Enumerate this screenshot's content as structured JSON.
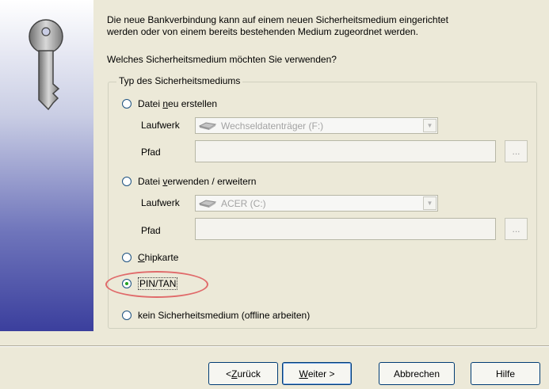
{
  "intro": {
    "line1": "Die neue Bankverbindung kann  auf einem neuen Sicherheitsmedium eingerichtet",
    "line2": "werden oder von einem bereits bestehenden Medium zugeordnet werden."
  },
  "question": "Welches Sicherheitsmedium möchten Sie verwenden?",
  "group_title": "Typ des Sicherheitsmediums",
  "options": {
    "new_file": {
      "pre": "Datei ",
      "access": "n",
      "post": "eu erstellen",
      "drive_label": "Laufwerk",
      "drive_value": "Wechseldatenträger (F:)",
      "path_label": "Pfad",
      "path_value": "",
      "browse": "..."
    },
    "use_file": {
      "pre": "Datei ",
      "access": "v",
      "post": "erwenden / erweitern",
      "drive_label": "Laufwerk",
      "drive_value": "ACER (C:)",
      "path_label": "Pfad",
      "path_value": "",
      "browse": "..."
    },
    "chipcard": {
      "access": "C",
      "post": "hipkarte"
    },
    "pin_tan": {
      "label": "PIN/TAN",
      "selected": true
    },
    "none": {
      "label": "kein Sicherheitsmedium (offline arbeiten)"
    }
  },
  "buttons": {
    "back": {
      "pre": "< ",
      "access": "Z",
      "post": "urück"
    },
    "next": {
      "access": "W",
      "post": "eiter >"
    },
    "cancel": "Abbrechen",
    "help": "Hilfe"
  },
  "colors": {
    "dialog_bg": "#ece9d8",
    "highlight_ring": "#e06a6a",
    "radio_dot": "#21a121",
    "side_panel_dark": "#3b3f9d"
  },
  "icons": {
    "side": "key-icon",
    "drive_removable": "removable-drive-icon",
    "drive_hard": "hard-drive-icon"
  }
}
